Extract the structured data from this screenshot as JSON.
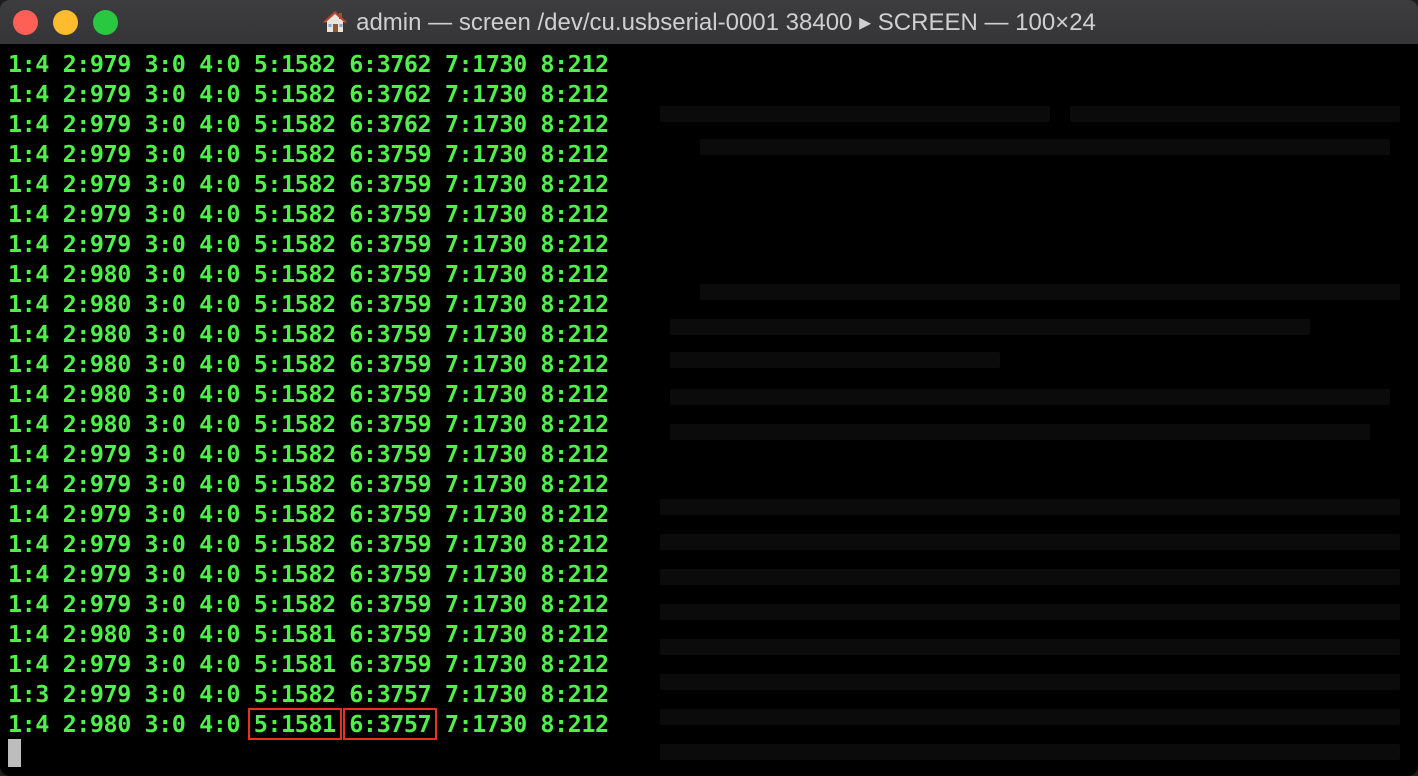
{
  "window": {
    "title": "admin — screen /dev/cu.usbserial-0001 38400 ▸ SCREEN — 100×24",
    "home_icon": "home-icon"
  },
  "colors": {
    "terminal_text": "#4ff04a",
    "terminal_bg": "#000000",
    "highlight_box": "#e8321f"
  },
  "terminal": {
    "lines": [
      [
        "1:4",
        "2:979",
        "3:0",
        "4:0",
        "5:1582",
        "6:3762",
        "7:1730",
        "8:212"
      ],
      [
        "1:4",
        "2:979",
        "3:0",
        "4:0",
        "5:1582",
        "6:3762",
        "7:1730",
        "8:212"
      ],
      [
        "1:4",
        "2:979",
        "3:0",
        "4:0",
        "5:1582",
        "6:3762",
        "7:1730",
        "8:212"
      ],
      [
        "1:4",
        "2:979",
        "3:0",
        "4:0",
        "5:1582",
        "6:3759",
        "7:1730",
        "8:212"
      ],
      [
        "1:4",
        "2:979",
        "3:0",
        "4:0",
        "5:1582",
        "6:3759",
        "7:1730",
        "8:212"
      ],
      [
        "1:4",
        "2:979",
        "3:0",
        "4:0",
        "5:1582",
        "6:3759",
        "7:1730",
        "8:212"
      ],
      [
        "1:4",
        "2:979",
        "3:0",
        "4:0",
        "5:1582",
        "6:3759",
        "7:1730",
        "8:212"
      ],
      [
        "1:4",
        "2:980",
        "3:0",
        "4:0",
        "5:1582",
        "6:3759",
        "7:1730",
        "8:212"
      ],
      [
        "1:4",
        "2:980",
        "3:0",
        "4:0",
        "5:1582",
        "6:3759",
        "7:1730",
        "8:212"
      ],
      [
        "1:4",
        "2:980",
        "3:0",
        "4:0",
        "5:1582",
        "6:3759",
        "7:1730",
        "8:212"
      ],
      [
        "1:4",
        "2:980",
        "3:0",
        "4:0",
        "5:1582",
        "6:3759",
        "7:1730",
        "8:212"
      ],
      [
        "1:4",
        "2:980",
        "3:0",
        "4:0",
        "5:1582",
        "6:3759",
        "7:1730",
        "8:212"
      ],
      [
        "1:4",
        "2:980",
        "3:0",
        "4:0",
        "5:1582",
        "6:3759",
        "7:1730",
        "8:212"
      ],
      [
        "1:4",
        "2:979",
        "3:0",
        "4:0",
        "5:1582",
        "6:3759",
        "7:1730",
        "8:212"
      ],
      [
        "1:4",
        "2:979",
        "3:0",
        "4:0",
        "5:1582",
        "6:3759",
        "7:1730",
        "8:212"
      ],
      [
        "1:4",
        "2:979",
        "3:0",
        "4:0",
        "5:1582",
        "6:3759",
        "7:1730",
        "8:212"
      ],
      [
        "1:4",
        "2:979",
        "3:0",
        "4:0",
        "5:1582",
        "6:3759",
        "7:1730",
        "8:212"
      ],
      [
        "1:4",
        "2:979",
        "3:0",
        "4:0",
        "5:1582",
        "6:3759",
        "7:1730",
        "8:212"
      ],
      [
        "1:4",
        "2:979",
        "3:0",
        "4:0",
        "5:1582",
        "6:3759",
        "7:1730",
        "8:212"
      ],
      [
        "1:4",
        "2:980",
        "3:0",
        "4:0",
        "5:1581",
        "6:3759",
        "7:1730",
        "8:212"
      ],
      [
        "1:4",
        "2:979",
        "3:0",
        "4:0",
        "5:1581",
        "6:3759",
        "7:1730",
        "8:212"
      ],
      [
        "1:3",
        "2:979",
        "3:0",
        "4:0",
        "5:1582",
        "6:3757",
        "7:1730",
        "8:212"
      ],
      [
        "1:4",
        "2:980",
        "3:0",
        "4:0",
        "5:1581",
        "6:3757",
        "7:1730",
        "8:212"
      ]
    ],
    "highlighted_last_line_fields": [
      4,
      5
    ]
  }
}
